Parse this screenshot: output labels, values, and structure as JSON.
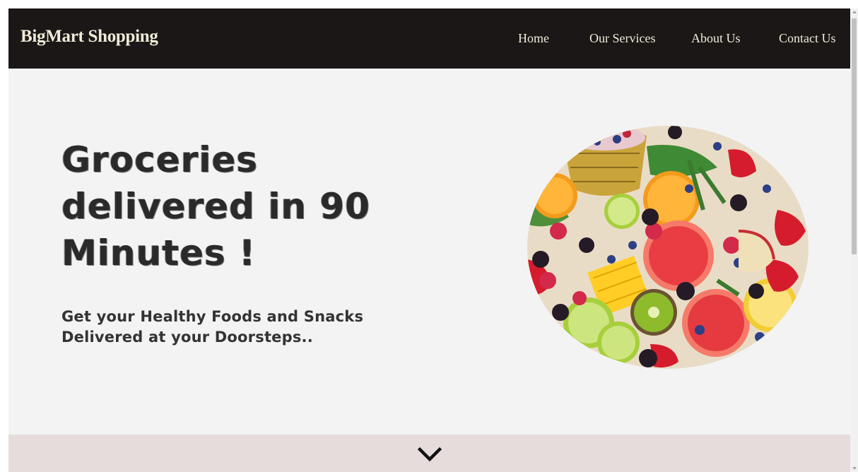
{
  "navbar": {
    "brand": "BigMart Shopping",
    "links": [
      {
        "label": "Home"
      },
      {
        "label": "Our Services"
      },
      {
        "label": "About Us"
      },
      {
        "label": "Contact Us"
      }
    ]
  },
  "hero": {
    "title": "Groceries delivered in 90 Minutes !",
    "subtitle": "Get your Healthy Foods and Snacks Delivered at your Doorsteps..",
    "image_icon": "fruit-platter-image"
  },
  "footer_band": {
    "icon": "chevron-down-icon"
  },
  "colors": {
    "navbar_bg": "#1a1716",
    "nav_text": "#f1ead9",
    "hero_bg": "#f3f3f3",
    "band_bg": "#e6dcdb"
  }
}
